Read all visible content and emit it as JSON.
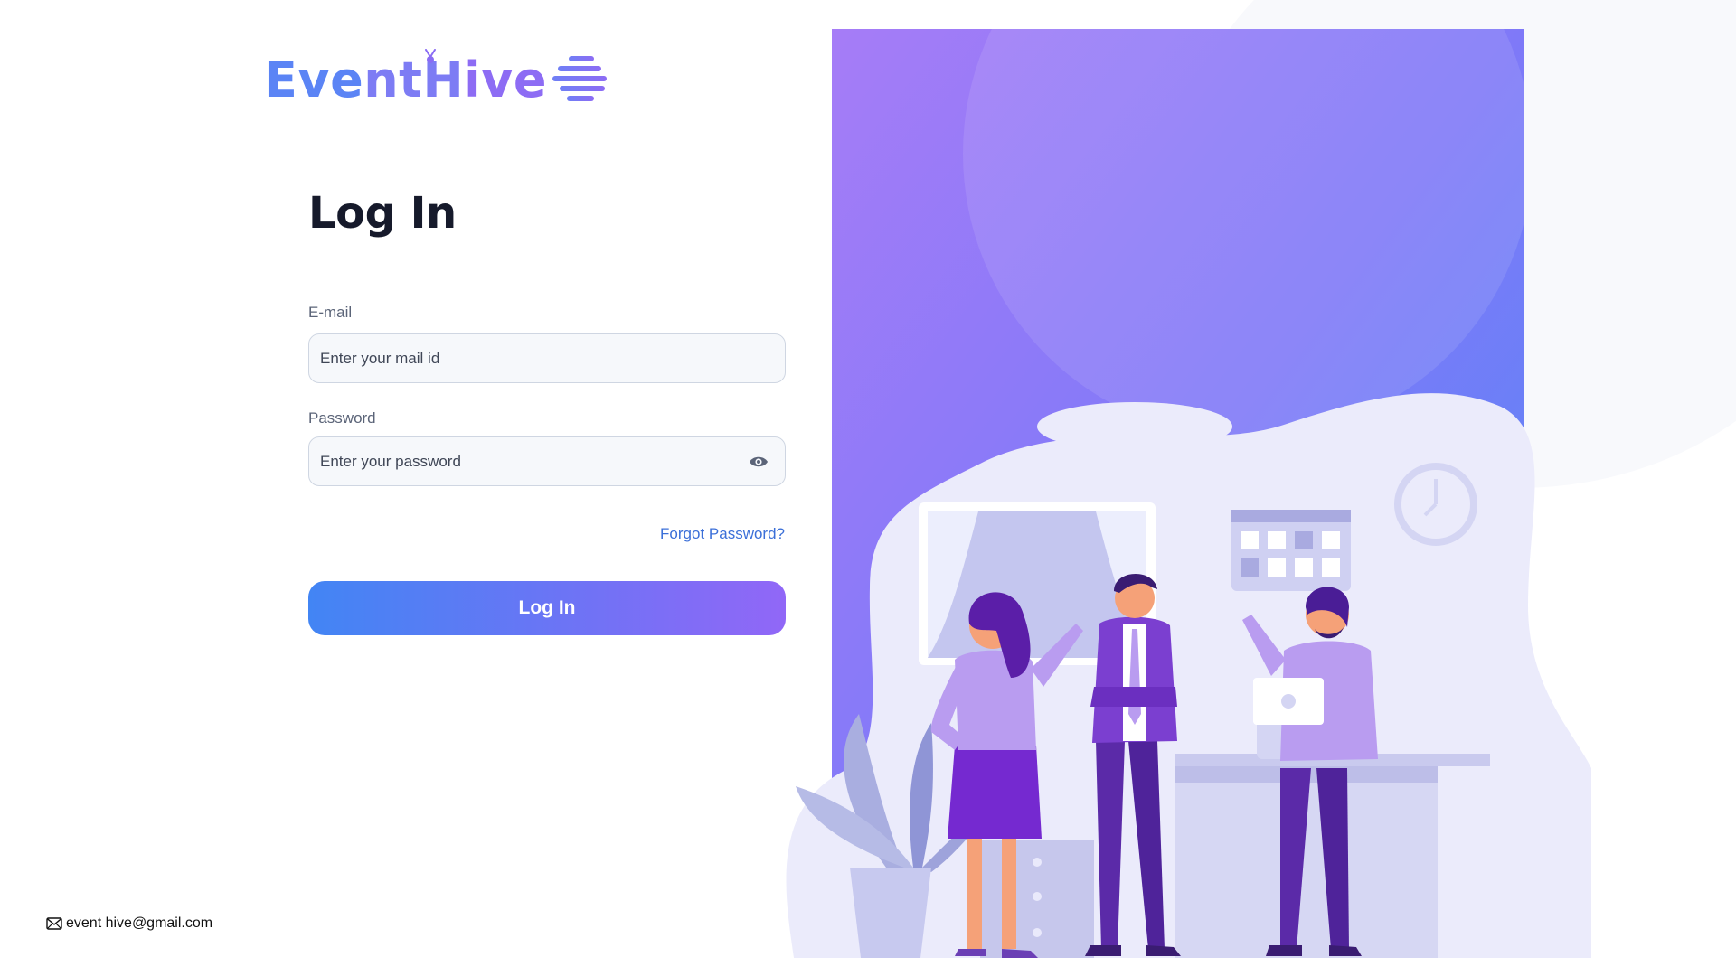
{
  "app": {
    "logo_text": "EventHive"
  },
  "colors": {
    "accent_blue": "#4285f4",
    "accent_purple": "#9167f7",
    "title": "#161a2b",
    "link": "#3b6fd8"
  },
  "login_form": {
    "title": "Log In",
    "email_label": "E-mail",
    "email_placeholder": "Enter your mail id",
    "email_value": "",
    "password_label": "Password",
    "password_placeholder": "Enter your password",
    "password_value": "",
    "toggle_visibility_icon": "eye-icon",
    "forgot_password_link": "Forgot Password?",
    "submit_label": "Log In"
  },
  "footer": {
    "email_icon": "mail-icon",
    "email_text": "event hive@gmail.com"
  },
  "illustration": {
    "subject": "office-team-illustration"
  }
}
